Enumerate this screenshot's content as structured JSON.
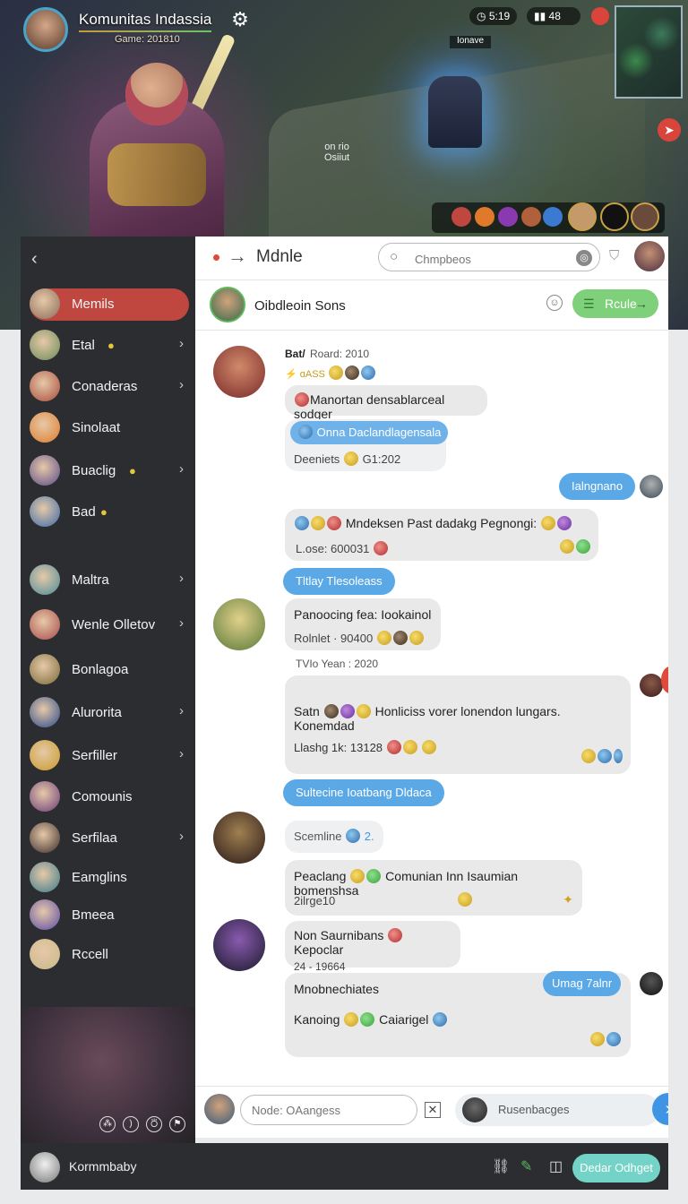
{
  "banner": {
    "title": "Komunitas Indassia",
    "subtitle": "Game: 201810",
    "hud": [
      "5:19",
      "48"
    ],
    "map_label": "Ionave",
    "floating_text": "on rio\nOsiiut"
  },
  "left": {
    "items": [
      {
        "label": "Memils",
        "chevron": false,
        "active": true,
        "color": "#8a6a5a"
      },
      {
        "label": "Etal",
        "emoji": true,
        "chevron": true,
        "color": "#6a8a5a"
      },
      {
        "label": "Conaderas",
        "chevron": true,
        "color": "#a84a3a"
      },
      {
        "label": "Sinolaat",
        "chevron": false,
        "color": "#e07a2a"
      },
      {
        "label": "Buaclig",
        "emoji": true,
        "chevron": true,
        "color": "#5a4a8a"
      },
      {
        "label": "Bad",
        "emoji": true,
        "chevron": false,
        "color": "#3a6aa8"
      },
      {
        "label": "Maltra",
        "chevron": true,
        "color": "#4a8a9a"
      },
      {
        "label": "Wenle Olletov",
        "chevron": true,
        "color": "#a84a4a"
      },
      {
        "label": "Bonlagoa",
        "chevron": false,
        "color": "#7a6a3a"
      },
      {
        "label": "Alurorita",
        "chevron": true,
        "color": "#2a4a8a"
      },
      {
        "label": "Serfiller",
        "chevron": true,
        "color": "#c89a2a"
      },
      {
        "label": "Comounis",
        "chevron": false,
        "color": "#6a3a7a"
      },
      {
        "label": "Serfilaa",
        "chevron": true,
        "color": "#3a2a2a"
      },
      {
        "label": "Eamglins",
        "chevron": false,
        "color": "#3a7a8a"
      },
      {
        "label": "Bmeea",
        "chevron": false,
        "color": "#5a4aa8"
      },
      {
        "label": "Rccell",
        "chevron": false,
        "color": "#c8b88a"
      }
    ],
    "controls": [
      "⁂",
      ")",
      "⛣",
      "⚑"
    ]
  },
  "chat": {
    "title": "Mdnle",
    "search_placeholder": "Chmpbeos",
    "contact_name": "Oibdleoin Sons",
    "route_label": "Rcule",
    "messages": {
      "m1_header": "Bat/",
      "m1_date": "Roard: 2010",
      "m1_tags": "⚡ ɑASS",
      "m1_text": "Manortan densablarceal sodger",
      "m1_quote": "Onna Daclandlagensala",
      "m1_meta": "Deeniets",
      "m1_meta_val": "G1:202",
      "out1": "Ialngnano",
      "m2_text": "Mndeksen Past dadakg Pegnongi:",
      "m2_meta": "L.ose: 600031",
      "pill1": "Tltlay Tlesoleass",
      "m3_text": "Panoocing fea: Iookainol",
      "m3_meta": "Rolnlet · 90400",
      "date2": "TVIo Yean : 2020",
      "m4_text_a": "Satn",
      "m4_text_b": "Honliciss vorer lonendon lungars.  Konemdad",
      "m4_meta": "Llashg 1k: 13128",
      "pill2": "Sultecine Ioatbang Dldaca",
      "m5_tag": "Scemline",
      "m5_tag_b": "2.",
      "m6_text_a": "Peaclang",
      "m6_text_b": "Comunian  Inn  Isaumian bomenshsa",
      "m6_meta": "2ilrge10",
      "m7_text": "Non Saurnibans",
      "m7_text_b": "Kepoclar",
      "m7_meta": "24 - 19664",
      "m8_text": "Mnobnechiates",
      "m8_pill": "Umag 7alnr",
      "m8_text_b": "Kanoing",
      "m8_text_c": "Caiarigel"
    },
    "input_placeholder": "Node: OAangess",
    "reply_field": "Rusenbacges"
  },
  "bottom": {
    "username": "Kormmbaby",
    "button": "Dedar Odhget"
  }
}
